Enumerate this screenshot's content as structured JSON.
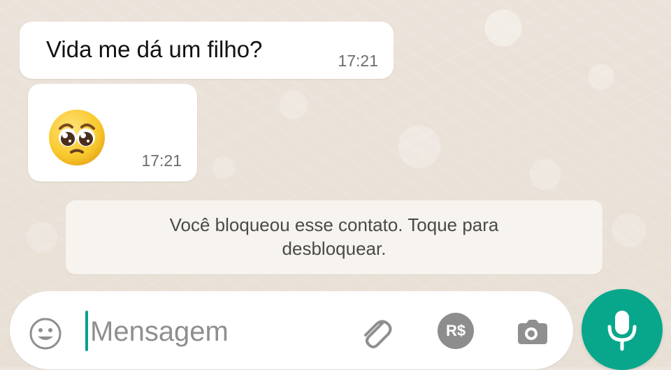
{
  "messages": [
    {
      "text": "Vida me dá um filho?",
      "time": "17:21"
    },
    {
      "emoji": "pleading-face",
      "time": "17:21"
    }
  ],
  "notice": {
    "line1": "Você bloqueou esse contato. Toque para",
    "line2": "desbloquear."
  },
  "composer": {
    "placeholder": "Mensagem",
    "currency_label": "R$"
  },
  "icons": {
    "emoji": "emoji-icon",
    "attach": "paperclip-icon",
    "currency": "currency-icon",
    "camera": "camera-icon",
    "mic": "microphone-icon"
  },
  "colors": {
    "accent": "#08a78c",
    "caret": "#07a289",
    "bubble": "#ffffff",
    "notice_bg": "#f7f3ee"
  }
}
